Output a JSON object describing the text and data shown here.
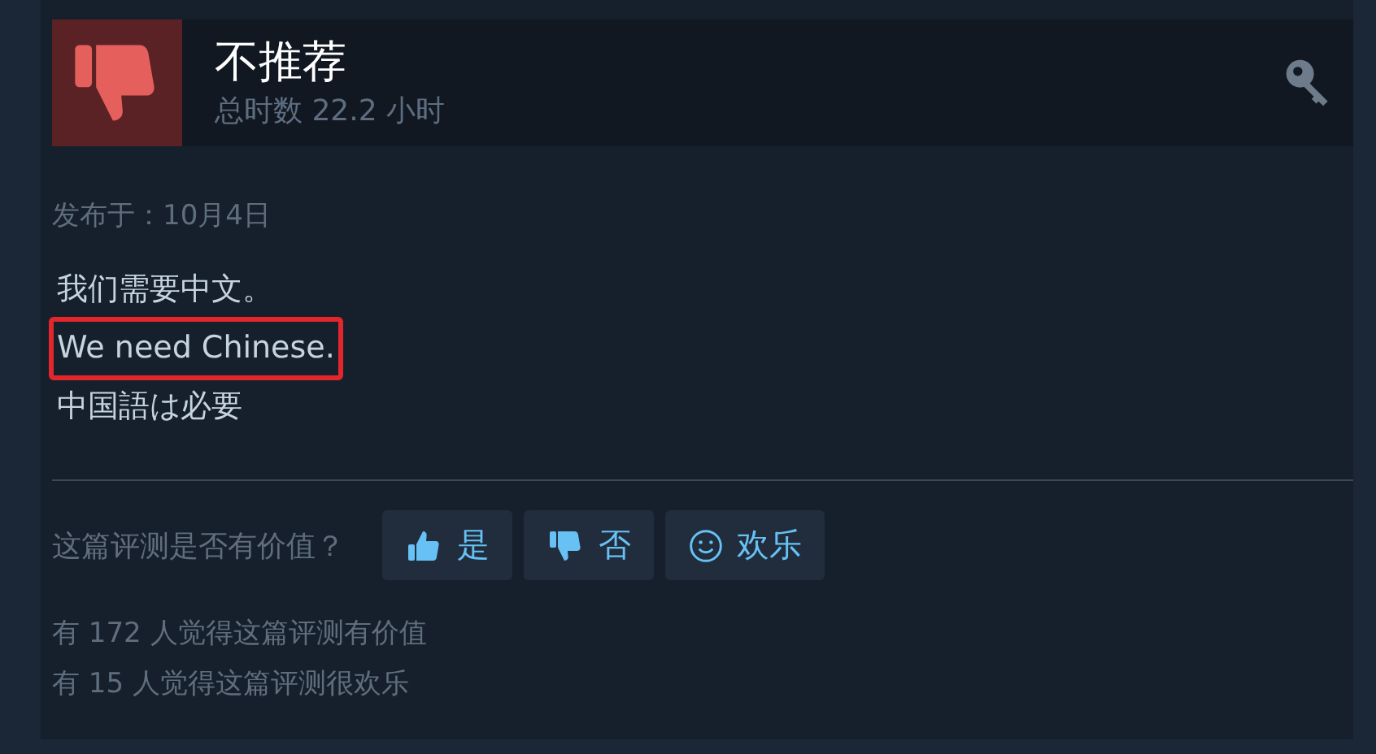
{
  "review": {
    "verdict": "不推荐",
    "recommended": false,
    "hours": "总时数 22.2 小时",
    "posted": "发布于：10月4日",
    "lines": [
      {
        "text": "我们需要中文。",
        "highlighted": false
      },
      {
        "text": "We need Chinese.",
        "highlighted": true
      },
      {
        "text": "中国語は必要",
        "highlighted": false
      }
    ],
    "prompt": "这篇评测是否有价值？",
    "buttons": [
      {
        "kind": "thumbs-up",
        "label": "是"
      },
      {
        "kind": "thumbs-down",
        "label": "否"
      },
      {
        "kind": "smile",
        "label": "欢乐"
      }
    ],
    "stats": [
      "有 172 人觉得这篇评测有价值",
      "有 15 人觉得这篇评测很欢乐"
    ]
  }
}
